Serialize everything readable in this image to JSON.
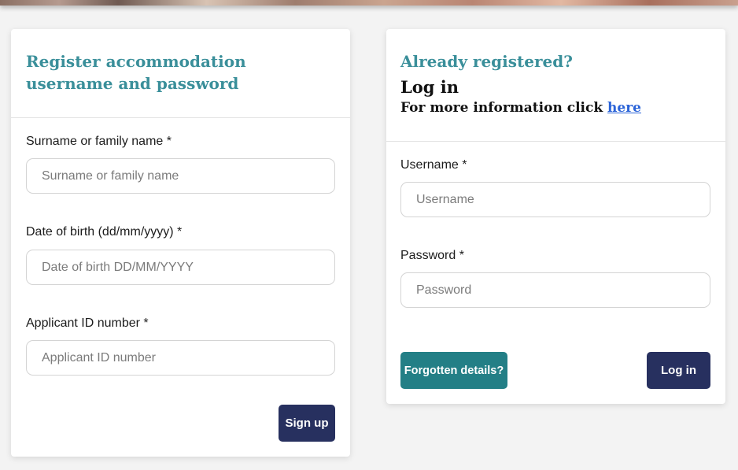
{
  "register": {
    "heading": "Register accommodation username and password",
    "surname": {
      "label": "Surname or family name *",
      "placeholder": "Surname or family name"
    },
    "dob": {
      "label": "Date of birth (dd/mm/yyyy) *",
      "placeholder": "Date of birth DD/MM/YYYY"
    },
    "applicant_id": {
      "label": "Applicant ID number *",
      "placeholder": "Applicant ID number"
    },
    "signup_label": "Sign up"
  },
  "login": {
    "heading": "Already registered?",
    "title": "Log in",
    "more_info_text": "For more information click ",
    "more_info_link": "here",
    "username": {
      "label": "Username *",
      "placeholder": "Username"
    },
    "password": {
      "label": "Password *",
      "placeholder": "Password"
    },
    "forgot_label": "Forgotten details?",
    "login_label": "Log in"
  },
  "colors": {
    "teal_heading": "#3a8f9a",
    "navy_button": "#27305f",
    "teal_button": "#237f86",
    "link": "#2a63d8"
  }
}
